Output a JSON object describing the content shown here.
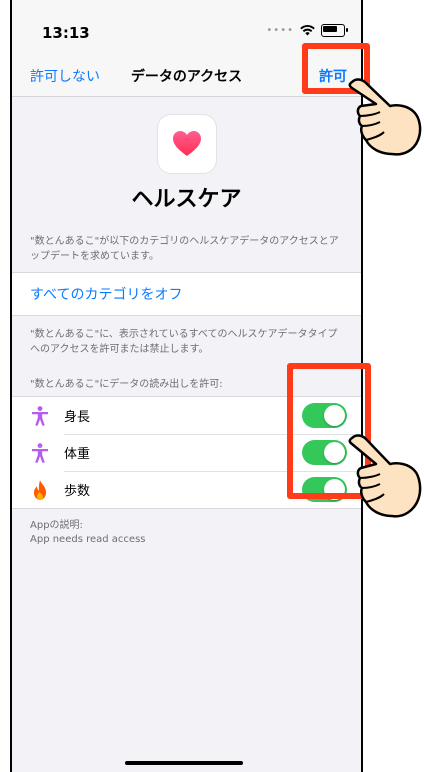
{
  "statusbar": {
    "time": "13:13"
  },
  "navbar": {
    "left": "許可しない",
    "title": "データのアクセス",
    "right": "許可"
  },
  "hero": {
    "title": "ヘルスケア"
  },
  "description": "\"数とんあるこ\"が以下のカテゴリのヘルスケアデータのアクセスとアップデートを求めています。",
  "all_off": "すべてのカテゴリをオフ",
  "note": "\"数とんあるこ\"に、表示されているすべてのヘルスケアデータタイプへのアクセスを許可または禁止します。",
  "read_header": "\"数とんあるこ\"にデータの読み出しを許可:",
  "rows": [
    {
      "label": "身長",
      "icon": "figure-icon",
      "on": true
    },
    {
      "label": "体重",
      "icon": "figure-icon",
      "on": true
    },
    {
      "label": "歩数",
      "icon": "flame-icon",
      "on": true
    }
  ],
  "app_desc_label": "Appの説明:",
  "app_desc_text": "App needs read access",
  "colors": {
    "accent": "#0a7aff",
    "toggle_on": "#34c759",
    "highlight": "#ff3b1a",
    "activity_purple": "#b65cf0",
    "flame_orange": "#ff5a00"
  }
}
